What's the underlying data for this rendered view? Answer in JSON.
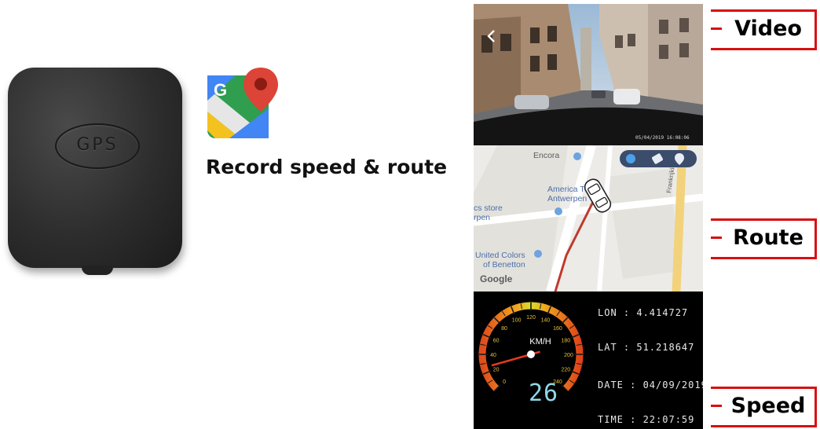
{
  "gps_module": {
    "label": "GPS"
  },
  "caption": "Record speed & route",
  "video": {
    "timestamp": "05/04/2019  16:08:06"
  },
  "map": {
    "places": {
      "encora": "Encora",
      "america_line1": "America T",
      "america_line2": "Antwerpen",
      "store_line1": "cs store",
      "store_line2": "rpen",
      "benetton_line1": "United Colors",
      "benetton_line2": "of Benetton",
      "street": "Frankrijklei"
    },
    "attribution": "Google"
  },
  "speedometer": {
    "unit": "KM/H",
    "current_speed": "26",
    "needle_value": 26,
    "max_value": 240,
    "tick_labels": [
      "0",
      "20",
      "40",
      "60",
      "80",
      "100",
      "120",
      "140",
      "160",
      "180",
      "200",
      "220",
      "240"
    ]
  },
  "readouts": {
    "lon": "LON : 4.414727",
    "lat": "LAT : 51.218647",
    "date": "DATE : 04/09/2019",
    "time": "TIME : 22:07:59"
  },
  "callouts": {
    "video": "Video",
    "route": "Route",
    "speed": "Speed"
  },
  "colors": {
    "callout_red": "#d80f10",
    "route_red": "#c0392b",
    "digit_cyan": "#8fd7e6"
  }
}
